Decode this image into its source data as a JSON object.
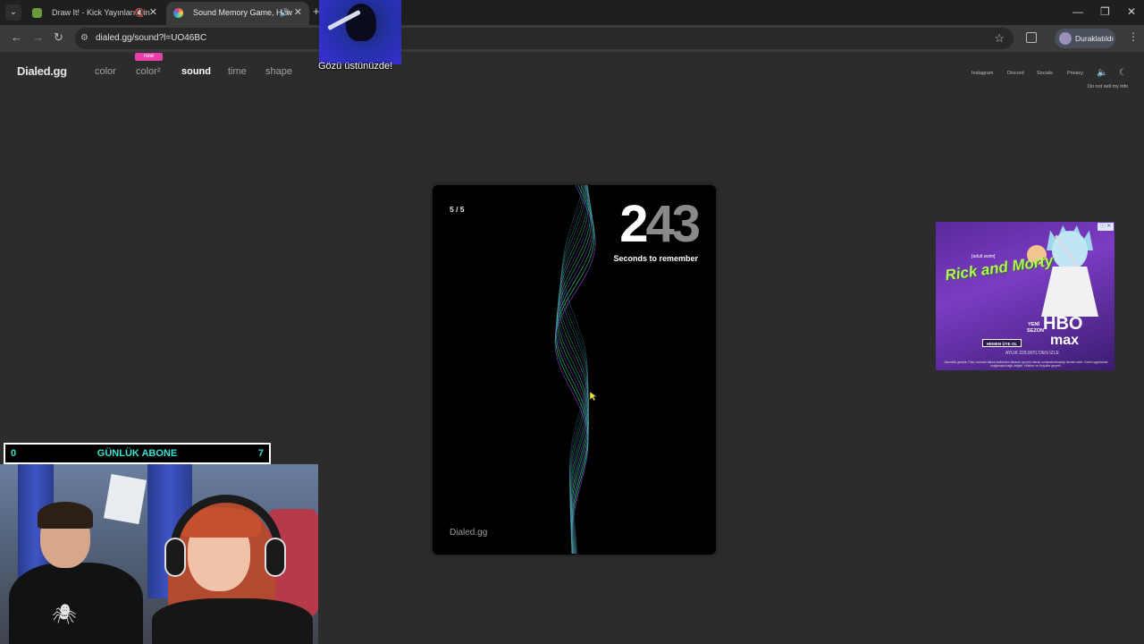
{
  "browser": {
    "tabs": [
      {
        "title": "Draw It! - Kick Yayınları İçin",
        "active": false,
        "muted": true
      },
      {
        "title": "Sound Memory Game, How",
        "active": true,
        "muted": false
      }
    ],
    "url": "dialed.gg/sound?l=UO46BC",
    "profile_label": "Duraklatıldı"
  },
  "site": {
    "logo": "Dialed.gg",
    "nav": [
      {
        "label": "color"
      },
      {
        "label": "color²",
        "badge": "new"
      },
      {
        "label": "sound",
        "current": true
      },
      {
        "label": "time"
      },
      {
        "label": "shape"
      }
    ],
    "links": [
      "Instagram",
      "Discord",
      "Socials",
      "Privacy"
    ],
    "do_not_sell": "Do not sell my info"
  },
  "game": {
    "round": "5 / 5",
    "timer_first": "2",
    "timer_rest": "43",
    "timer_label": "Seconds to remember",
    "card_logo": "Dialed.gg"
  },
  "ad": {
    "title": "Rick and Morty",
    "adult": "[adult swim]",
    "yeni": "YENİ SEZON",
    "hbo": "HBO",
    "max": "max",
    "cta": "HEMEN ÜYE OL",
    "price": "AYLIK 229,90TL'DEN İZLE",
    "fine": "Abonelik gerekir. Plan, sonraki fatura tarihinden itibaren geçerli olarak sonlandırılmadığı devam eder. Ücret uygulamalı mağazaya bağlı değişir. Hüküm ve Koşullar geçerli."
  },
  "stream": {
    "overlay_caption": "Gözü üstünüzde!",
    "sub_count": "0",
    "sub_label": "GÜNLÜK ABONE",
    "sub_goal": "7"
  },
  "colors": {
    "page_bg": "#2c2c2c",
    "card_bg": "#000000",
    "wave_green": "#2fd39a",
    "wave_purple": "#8a3fd6",
    "new_badge": "#e83fa8",
    "sub_text": "#37e0d0"
  }
}
